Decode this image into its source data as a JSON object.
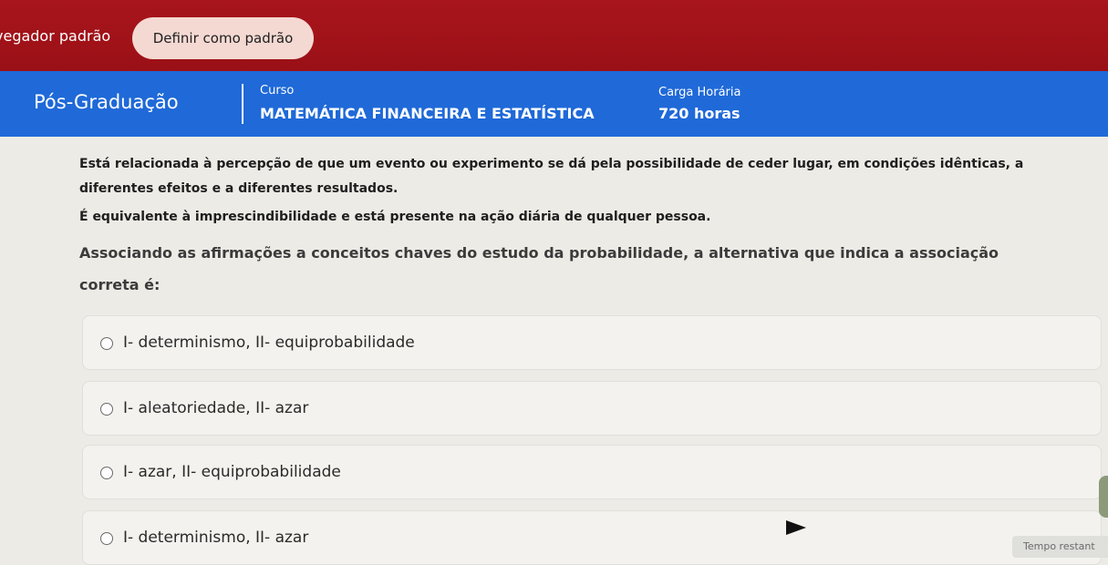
{
  "browser_prompt": {
    "label": "vegador padrão",
    "button_label": "Definir como padrão"
  },
  "header": {
    "program": "Pós-Graduação",
    "course_caption": "Curso",
    "course_name": "MATEMÁTICA FINANCEIRA E ESTATÍSTICA",
    "hours_caption": "Carga Horária",
    "hours_value": "720 horas"
  },
  "question": {
    "line1": "Está relacionada à percepção de que um evento ou experimento se dá pela possibilidade de ceder lugar, em condições idênticas, a",
    "line2": "diferentes efeitos e a diferentes resultados.",
    "line3": "É equivalente à imprescindibilidade e está presente na ação diária de qualquer pessoa.",
    "prompt_line1": "Associando as afirmações a conceitos chaves do estudo da probabilidade, a alternativa que indica a associação",
    "prompt_line2": "correta é:"
  },
  "options": [
    "I- determinismo, II- equiprobabilidade",
    "I- aleatoriedade, II- azar",
    "I- azar, II- equiprobabilidade",
    "I- determinismo, II- azar"
  ],
  "timer": {
    "label": "Tempo restant"
  }
}
